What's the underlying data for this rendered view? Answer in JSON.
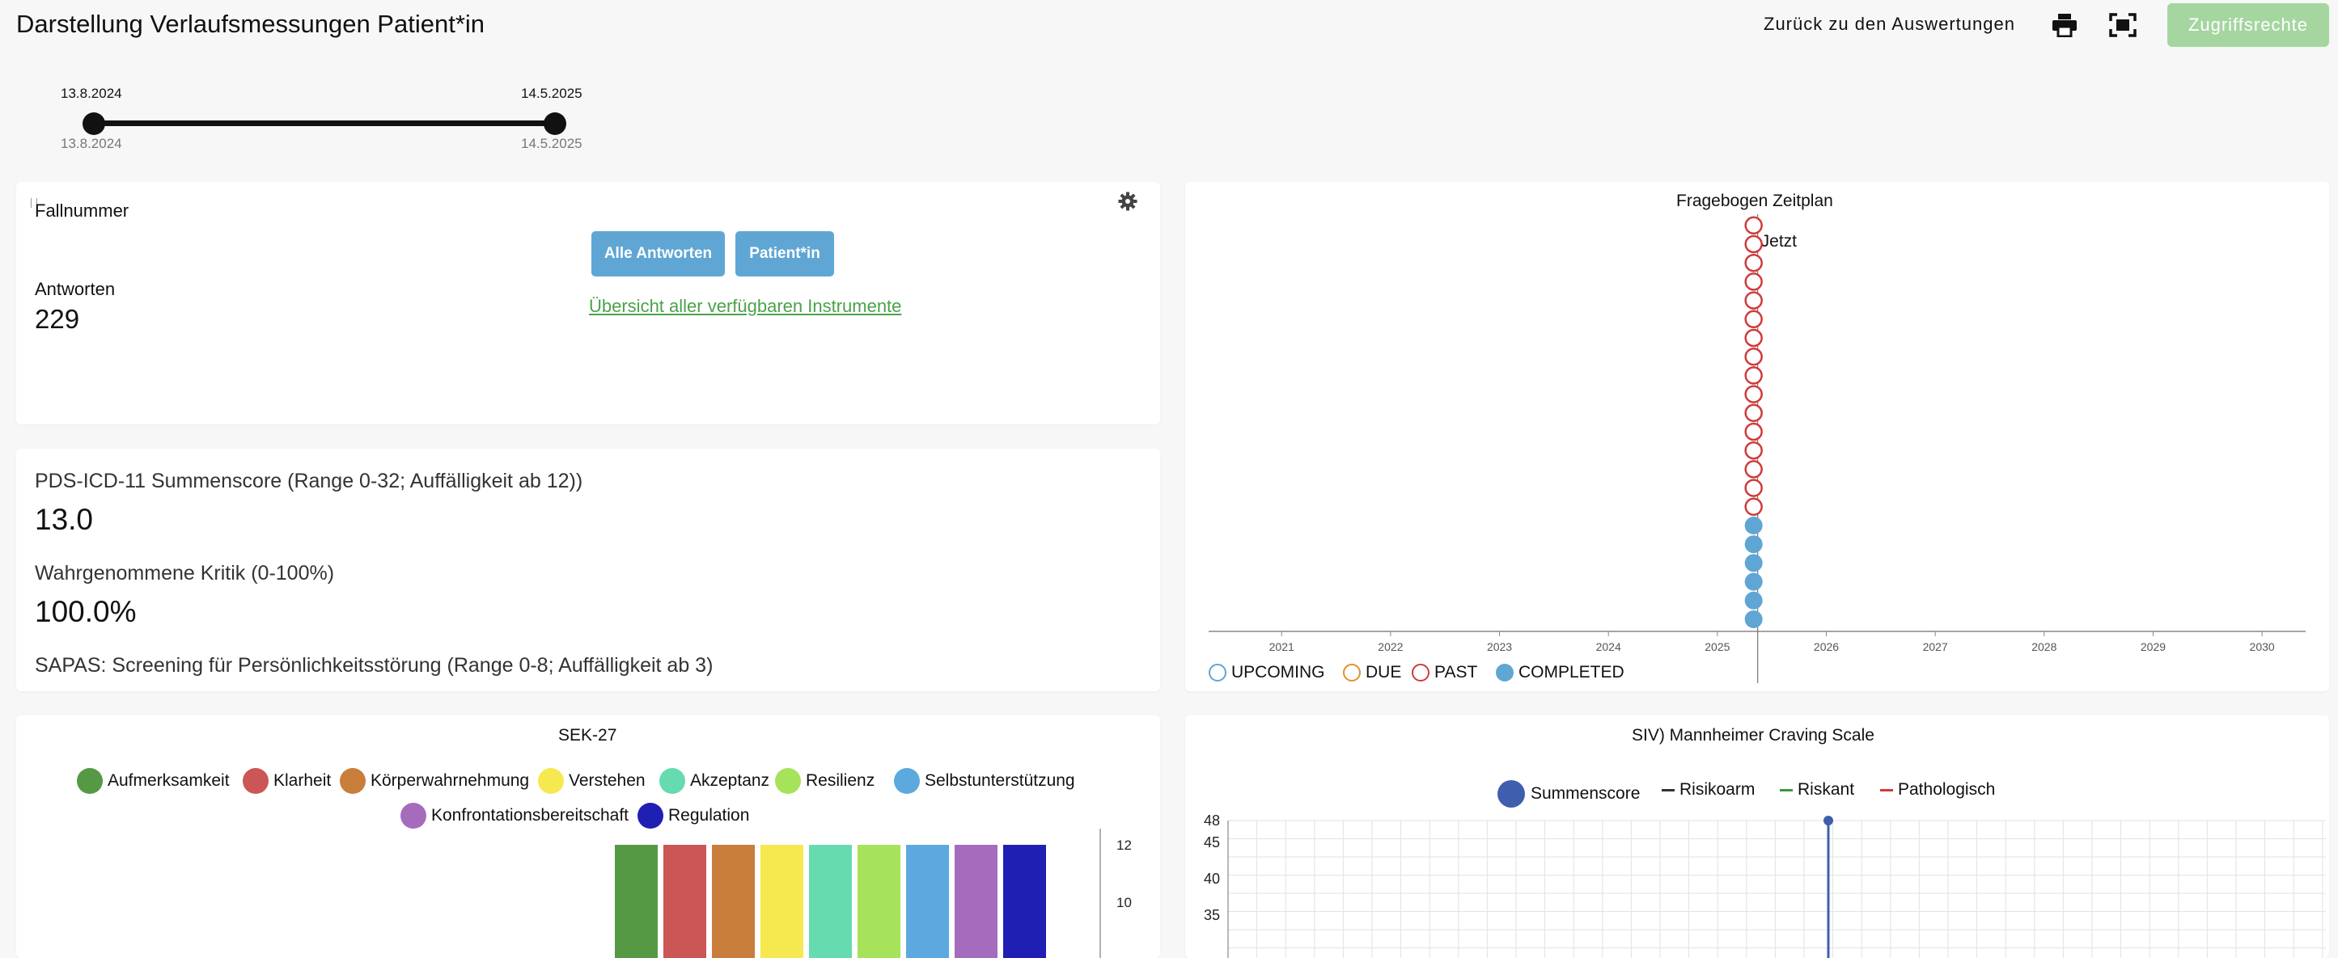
{
  "header": {
    "title": "Darstellung Verlaufsmessungen Patient*in",
    "back_link": "Zurück zu den Auswertungen",
    "icons": [
      "printer-icon",
      "fullscreen-icon"
    ],
    "access_button": "Zugriffsrechte"
  },
  "date_range": {
    "start_top": "13.8.2024",
    "end_top": "14.5.2025",
    "start_bottom": "13.8.2024",
    "end_bottom": "14.5.2025"
  },
  "case_panel": {
    "case_label": "Fallnummer",
    "answers_label": "Antworten",
    "answers_value": "229",
    "btn_all_answers": "Alle Antworten",
    "btn_patient": "Patient*in",
    "instruments_link": "Übersicht aller verfügbaren Instrumente",
    "settings_icon": "gear-icon"
  },
  "scores": [
    {
      "title": "PDS-ICD-11 Summenscore (Range 0-32; Auffälligkeit ab 12))",
      "value": "13.0"
    },
    {
      "title": "Wahrgenommene Kritik (0-100%)",
      "value": "100.0%"
    },
    {
      "title": "SAPAS: Screening für Persönlichkeitsstörung (Range 0-8; Auffälligkeit ab 3)",
      "value": ""
    }
  ],
  "chart_data": [
    {
      "type": "scatter",
      "title": "Fragebogen Zeitplan",
      "x_ticks": [
        "2021",
        "2022",
        "2023",
        "2024",
        "2025",
        "2026",
        "2027",
        "2028",
        "2029",
        "2030"
      ],
      "now_label": "Jetzt",
      "now_x": 2025.37,
      "legend": [
        "UPCOMING",
        "DUE",
        "PAST",
        "COMPLETED"
      ],
      "status_colors": {
        "UPCOMING": "#5fa6d4",
        "DUE": "#e3902b",
        "PAST": "#cf3b3b",
        "COMPLETED": "#5fa6d4"
      },
      "series": [
        {
          "name": "PAST",
          "count": 16
        },
        {
          "name": "COMPLETED",
          "count": 6
        }
      ]
    },
    {
      "type": "bar",
      "title": "SEK-27",
      "categories": [
        "Aufmerksamkeit",
        "Klarheit",
        "Körperwahrnehmung",
        "Verstehen",
        "Akzeptanz",
        "Resilienz",
        "Selbstunterstützung",
        "Konfrontationsbereitschaft",
        "Regulation"
      ],
      "colors": [
        "#559944",
        "#cc5555",
        "#c97d3a",
        "#f5e94f",
        "#66dbb0",
        "#a6e25a",
        "#5ba9df",
        "#a56cbe",
        "#1f1fb4"
      ],
      "y_ticks": [
        10,
        12
      ],
      "ylim": [
        0,
        12
      ]
    },
    {
      "type": "line",
      "title": "SIV) Mannheimer Craving Scale",
      "legend": [
        "Summenscore",
        "Risikoarm",
        "Riskant",
        "Pathologisch"
      ],
      "colors": {
        "Summenscore": "#3f5fae",
        "Risikoarm": "#333333",
        "Riskant": "#3a9a3a",
        "Pathologisch": "#cf3b3b"
      },
      "y_ticks": [
        35,
        40,
        45,
        48
      ],
      "ylim": [
        0,
        48
      ]
    }
  ]
}
